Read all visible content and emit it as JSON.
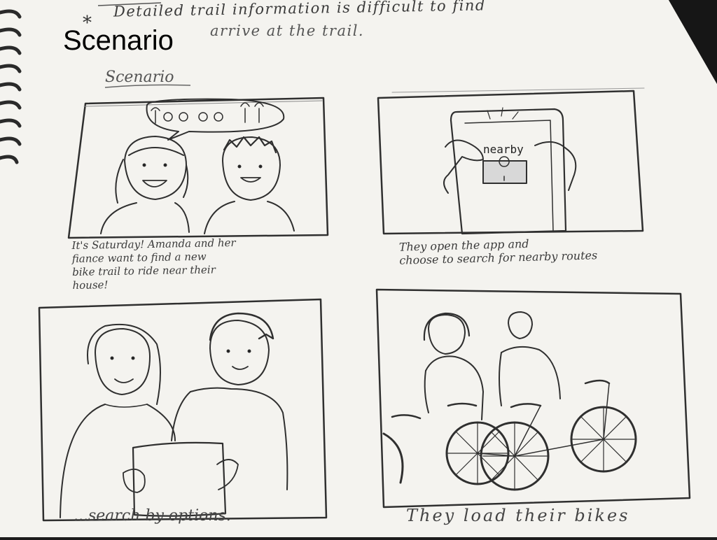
{
  "slide": {
    "title": "Scenario"
  },
  "notebook": {
    "header_star": "*",
    "header_line": "Detailed trail information is difficult to find",
    "header_line2": "arrive at the trail.",
    "section_label": "Scenario"
  },
  "panels": [
    {
      "caption": "It's Saturday! Amanda and her\nfiance want to find a new\nbike trail to ride near their\nhouse!"
    },
    {
      "caption": "They open the app and\nchoose to search for nearby routes",
      "screen_button": "nearby"
    },
    {
      "caption": "...search by options."
    },
    {
      "caption": "They load their bikes"
    }
  ]
}
